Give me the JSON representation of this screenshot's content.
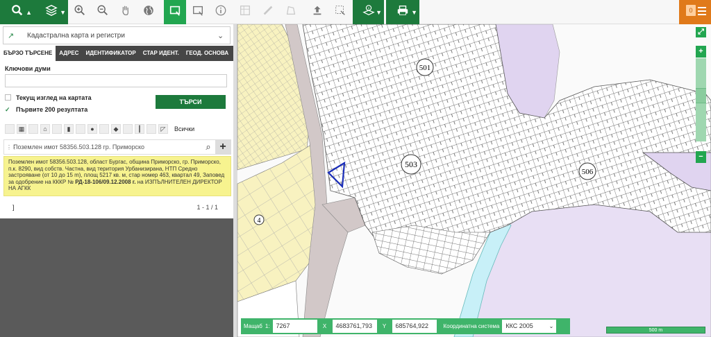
{
  "toolbar": {
    "tools": [
      {
        "name": "search-icon",
        "style": "dark"
      },
      {
        "name": "layers-icon",
        "style": "dark"
      },
      {
        "name": "zoom-in-icon",
        "style": "plain"
      },
      {
        "name": "zoom-out-icon",
        "style": "plain"
      },
      {
        "name": "pan-hand-icon",
        "style": "plain"
      },
      {
        "name": "globe-icon",
        "style": "plain"
      },
      {
        "name": "select-area-icon",
        "style": "green"
      },
      {
        "name": "select-rect-icon",
        "style": "plain"
      },
      {
        "name": "info-icon",
        "style": "plain"
      },
      {
        "name": "table-icon",
        "style": "dim"
      },
      {
        "name": "measure-line-icon",
        "style": "dim"
      },
      {
        "name": "measure-area-icon",
        "style": "dim"
      },
      {
        "name": "upload-icon",
        "style": "plain"
      },
      {
        "name": "clear-selection-icon",
        "style": "plain"
      },
      {
        "name": "identify-icon",
        "style": "dark"
      },
      {
        "name": "print-icon",
        "style": "dark"
      }
    ],
    "notification_count": "0"
  },
  "panel": {
    "layer_selector": "Кадастрална карта и регистри",
    "tabs": [
      "БЪРЗО ТЪРСЕНЕ",
      "АДРЕС",
      "ИДЕНТИФИКАТОР",
      "СТАР ИДЕНТ.",
      "ГЕОД. ОСНОВА"
    ],
    "keywords_label": "Ключови думи",
    "keywords_value": "",
    "current_view_label": "Текущ изглед на картата",
    "first200_label": "Първите 200 резултата",
    "search_button": "ТЪРСИ",
    "filter_all_label": "Всички",
    "result_title": "Поземлен имот 58356.503.128 гр. Приморско",
    "result_text_1": "Поземлен имот 58356.503.128, област Бургас, община Приморско, гр. Приморско, п.к. 8290, вид собств. Частна, вид територия Урбанизирана, НТП Средно застрояване (от 10 до 15 m), площ 5217 кв. м, стар номер 463, квартал 49, Заповед за одобрение на КККР № ",
    "result_text_bold": "РД-18-106/09.12.2008 г.",
    "result_text_2": " на ИЗПЪЛНИТЕЛЕН ДИРЕКТОР НА АГКК",
    "pager_left": "]",
    "pager_right": "1 - 1 / 1"
  },
  "map": {
    "district_labels": [
      "501",
      "503",
      "506",
      "4"
    ],
    "scale_label": "Мащаб",
    "scale_prefix": "1:",
    "scale_value": "7267",
    "x_label": "X",
    "x_value": "4683761,793",
    "y_label": "Y",
    "y_value": "685764,922",
    "crs_label": "Координатна система",
    "crs_value": "ККС 2005",
    "scalebar_text": "500 m",
    "zoom_in": "+",
    "zoom_out": "−",
    "colors": {
      "urban_yellow": "#f8f2c0",
      "water": "#c8f0f8",
      "purple": "#e0d4f0",
      "road": "#d2c8c8"
    }
  }
}
